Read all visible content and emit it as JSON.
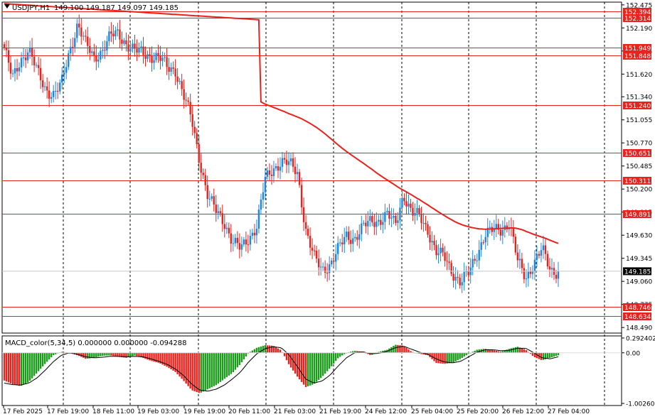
{
  "header": {
    "symbol_tf": "USDJPY,H1",
    "ohlc": "149.100 149.187 149.097 149.185",
    "macd_label": "MACD_color(5,34,5) 0.000000 0.000000 -0.094288"
  },
  "colors": {
    "background": "#ffffff",
    "grid": "#000000",
    "bull": "#1f86e0",
    "bear": "#e8221d",
    "level_line": "#e8221d",
    "ma": "#e8221d",
    "hist_pos": "#1a9b1a",
    "hist_neg": "#e8221d"
  },
  "icons": {
    "dropdown": "triangle-down-icon"
  },
  "chart_data": [
    {
      "type": "candlestick",
      "symbol": "USDJPY",
      "timeframe": "H1",
      "price_axis_ticks": [
        "152.475",
        "152.190",
        "151.905",
        "151.620",
        "151.340",
        "151.055",
        "150.770",
        "150.485",
        "150.200",
        "149.915",
        "149.630",
        "149.345",
        "149.060",
        "148.775",
        "148.490"
      ],
      "ylim": [
        148.43,
        152.5
      ],
      "current_price": "149.185",
      "horizontal_levels": [
        152.394,
        152.314,
        151.949,
        151.848,
        151.24,
        150.651,
        150.311,
        149.891,
        148.746,
        148.634
      ],
      "level_labels": [
        "152.394",
        "152.314",
        "151.949",
        "151.848",
        "151.240",
        "150.651",
        "150.311",
        "149.891",
        "148.746",
        "148.634"
      ],
      "time_labels": [
        "17 Feb 2025",
        "17 Feb 19:00",
        "18 Feb 11:00",
        "19 Feb 03:00",
        "19 Feb 19:00",
        "20 Feb 11:00",
        "21 Feb 03:00",
        "21 Feb 19:00",
        "24 Feb 12:00",
        "25 Feb 04:00",
        "25 Feb 20:00",
        "26 Feb 12:00",
        "27 Feb 04:00"
      ],
      "close_path": [
        151.94,
        151.55,
        151.8,
        151.93,
        151.65,
        151.45,
        151.37,
        151.48,
        151.9,
        152.25,
        151.98,
        151.82,
        151.92,
        152.08,
        152.12,
        152.0,
        151.9,
        151.88,
        151.85,
        151.82,
        151.7,
        151.68,
        151.35,
        151.05,
        150.55,
        150.1,
        149.92,
        149.8,
        149.55,
        149.45,
        149.6,
        149.75,
        150.3,
        150.45,
        150.55,
        150.5,
        150.4,
        149.7,
        149.35,
        149.2,
        149.28,
        149.45,
        149.62,
        149.6,
        149.72,
        149.8,
        149.82,
        149.88,
        149.75,
        150.15,
        149.9,
        149.85,
        149.7,
        149.42,
        149.35,
        149.18,
        149.05,
        149.15,
        149.4,
        149.65,
        149.68,
        149.7,
        149.8,
        149.3,
        149.1,
        149.3,
        149.45,
        149.2,
        149.185
      ],
      "macd_axis_ticks": [
        "0.292402",
        "0.00",
        "-1.002605"
      ],
      "macd_ylim": [
        -1.03,
        0.32
      ],
      "macd_hist": [
        -0.55,
        -0.62,
        -0.66,
        -0.58,
        -0.4,
        -0.22,
        -0.05,
        0.02,
        0.0,
        -0.05,
        -0.12,
        -0.1,
        -0.06,
        -0.05,
        -0.08,
        -0.1,
        -0.05,
        -0.1,
        -0.16,
        -0.2,
        -0.28,
        -0.38,
        -0.55,
        -0.74,
        -0.8,
        -0.72,
        -0.64,
        -0.52,
        -0.4,
        -0.22,
        0.0,
        0.1,
        0.15,
        0.14,
        0.05,
        -0.25,
        -0.48,
        -0.68,
        -0.62,
        -0.48,
        -0.3,
        -0.1,
        0.0,
        0.04,
        0.02,
        -0.05,
        0.02,
        0.06,
        0.16,
        0.14,
        0.02,
        -0.02,
        -0.05,
        -0.2,
        -0.22,
        -0.2,
        -0.12,
        -0.02,
        0.06,
        0.08,
        0.05,
        0.02,
        0.08,
        0.12,
        0.06,
        -0.08,
        -0.15,
        -0.1,
        -0.05
      ],
      "macd_signal": [
        -0.6,
        -0.63,
        -0.64,
        -0.6,
        -0.5,
        -0.35,
        -0.18,
        -0.05,
        0.0,
        -0.03,
        -0.08,
        -0.1,
        -0.09,
        -0.07,
        -0.07,
        -0.08,
        -0.07,
        -0.08,
        -0.12,
        -0.17,
        -0.23,
        -0.32,
        -0.45,
        -0.62,
        -0.74,
        -0.76,
        -0.72,
        -0.64,
        -0.52,
        -0.38,
        -0.18,
        -0.02,
        0.08,
        0.12,
        0.1,
        -0.05,
        -0.28,
        -0.52,
        -0.6,
        -0.56,
        -0.44,
        -0.26,
        -0.1,
        0.0,
        0.02,
        -0.02,
        -0.01,
        0.03,
        0.1,
        0.13,
        0.07,
        0.01,
        -0.03,
        -0.12,
        -0.18,
        -0.2,
        -0.17,
        -0.08,
        0.01,
        0.06,
        0.06,
        0.04,
        0.05,
        0.09,
        0.09,
        0.0,
        -0.1,
        -0.12,
        -0.08
      ]
    }
  ]
}
